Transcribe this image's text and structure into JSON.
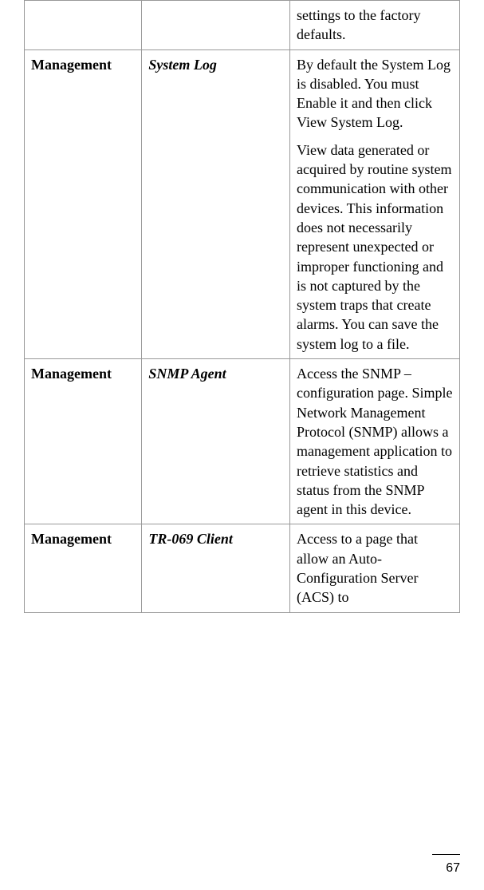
{
  "table": {
    "rows": [
      {
        "col1": "",
        "col2": "",
        "desc": [
          "settings to the factory defaults."
        ]
      },
      {
        "col1": "Management",
        "col2": "System Log",
        "desc": [
          "By default the System Log is disabled.  You must Enable it and then click View System Log.",
          "View data generated or acquired by routine system communication with other devices. This information does not necessarily represent unexpected or improper functioning and is not captured by the system traps that create alarms. You can save the system log to a file."
        ]
      },
      {
        "col1": "Management",
        "col2": "SNMP Agent",
        "desc": [
          "Access the SNMP – configuration page. Simple Network Management Protocol (SNMP) allows a management application to retrieve statistics and status from the SNMP agent in this device."
        ]
      },
      {
        "col1": "Management",
        "col2": "TR-069 Client",
        "desc": [
          "Access to a page that allow an Auto-Configuration Server (ACS) to"
        ]
      }
    ]
  },
  "page_number": "67"
}
